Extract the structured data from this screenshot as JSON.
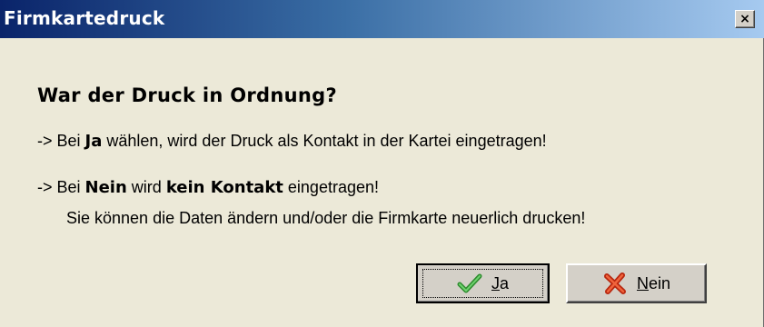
{
  "window": {
    "title": "Firmkartedruck",
    "close_symbol": "×"
  },
  "message": {
    "question": "War der Druck in Ordnung?",
    "line1": {
      "prefix": "-> Bei ",
      "bold": "Ja",
      "suffix": "  wählen, wird der Druck als Kontakt in der Kartei  eingetragen!"
    },
    "line2": {
      "prefix": "-> Bei ",
      "bold1": "Nein",
      "middle": " wird ",
      "bold2": "kein Kontakt",
      "suffix": " eingetragen!"
    },
    "line3": "Sie können die Daten ändern und/oder die Firmkarte neuerlich drucken!"
  },
  "buttons": {
    "yes": {
      "mnemonic": "J",
      "rest": "a",
      "icon": "checkmark-icon",
      "color": "#3aa63a"
    },
    "no": {
      "mnemonic": "N",
      "rest": "ein",
      "icon": "red-x-icon",
      "color": "#d03a1e"
    }
  }
}
